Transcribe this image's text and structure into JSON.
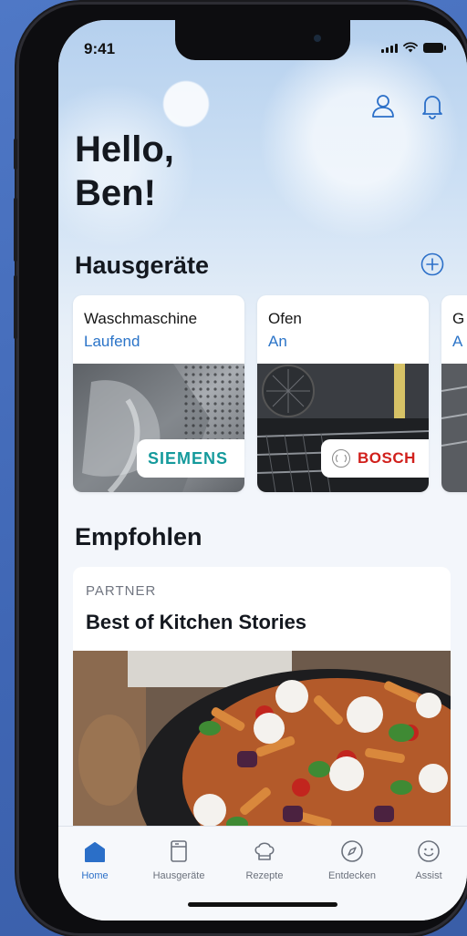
{
  "status_bar": {
    "time": "9:41"
  },
  "header": {
    "greeting_line1": "Hello,",
    "greeting_line2": "Ben!",
    "icons": [
      "user-icon",
      "bell-icon"
    ]
  },
  "appliances": {
    "title": "Hausgeräte",
    "add_icon": "plus-circle-icon",
    "items": [
      {
        "name": "Waschmaschine",
        "status": "Laufend",
        "brand": "SIEMENS"
      },
      {
        "name": "Ofen",
        "status": "An",
        "brand": "BOSCH"
      },
      {
        "name": "G",
        "status": "A",
        "brand": ""
      }
    ]
  },
  "recommended": {
    "title": "Empfohlen",
    "card": {
      "partner_label": "PARTNER",
      "title": "Best of Kitchen Stories"
    }
  },
  "tabbar": {
    "tabs": [
      {
        "label": "Home",
        "icon": "home-icon",
        "active": true
      },
      {
        "label": "Hausgeräte",
        "icon": "appliance-icon",
        "active": false
      },
      {
        "label": "Rezepte",
        "icon": "chef-hat-icon",
        "active": false
      },
      {
        "label": "Entdecken",
        "icon": "compass-icon",
        "active": false
      },
      {
        "label": "Assist",
        "icon": "smiley-icon",
        "active": false
      }
    ]
  },
  "colors": {
    "accent": "#2b6fc8",
    "status_blue": "#2b74c8",
    "siemens": "#159a9c",
    "bosch": "#d1201c",
    "background": "#4f78c6"
  }
}
